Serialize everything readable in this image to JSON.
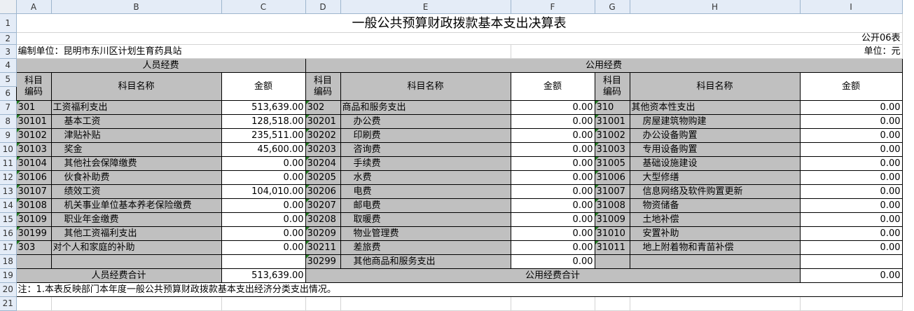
{
  "columns": [
    "A",
    "B",
    "C",
    "D",
    "E",
    "F",
    "G",
    "H",
    "I"
  ],
  "rows": [
    "1",
    "2",
    "3",
    "4",
    "5",
    "6",
    "7",
    "8",
    "9",
    "10",
    "11",
    "12",
    "13",
    "14",
    "15",
    "16",
    "17",
    "18",
    "19",
    "20",
    "21"
  ],
  "title": "一般公共预算财政拨款基本支出决算表",
  "table_no": "公开06表",
  "unit_label": "编制单位：昆明市东川区计划生育药具站",
  "currency": "单位：元",
  "section_personnel": "人员经费",
  "section_public": "公用经费",
  "hdr": {
    "code1": "科目",
    "code2": "编码",
    "name": "科目名称",
    "amount": "金额"
  },
  "personnel": [
    {
      "code": "301",
      "name": "工资福利支出",
      "amount": "513,639.00",
      "sub": false
    },
    {
      "code": "30101",
      "name": "基本工资",
      "amount": "128,518.00",
      "sub": true
    },
    {
      "code": "30102",
      "name": "津贴补贴",
      "amount": "235,511.00",
      "sub": true
    },
    {
      "code": "30103",
      "name": "奖金",
      "amount": "45,600.00",
      "sub": true
    },
    {
      "code": "30104",
      "name": "其他社会保障缴费",
      "amount": "0.00",
      "sub": true
    },
    {
      "code": "30106",
      "name": "伙食补助费",
      "amount": "0.00",
      "sub": true
    },
    {
      "code": "30107",
      "name": "绩效工资",
      "amount": "104,010.00",
      "sub": true
    },
    {
      "code": "30108",
      "name": "机关事业单位基本养老保险缴费",
      "amount": "0.00",
      "sub": true
    },
    {
      "code": "30109",
      "name": "职业年金缴费",
      "amount": "0.00",
      "sub": true
    },
    {
      "code": "30199",
      "name": "其他工资福利支出",
      "amount": "0.00",
      "sub": true
    },
    {
      "code": "303",
      "name": "对个人和家庭的补助",
      "amount": "0.00",
      "sub": false
    }
  ],
  "public1": [
    {
      "code": "302",
      "name": "商品和服务支出",
      "amount": "0.00",
      "sub": false
    },
    {
      "code": "30201",
      "name": "办公费",
      "amount": "0.00",
      "sub": true
    },
    {
      "code": "30202",
      "name": "印刷费",
      "amount": "0.00",
      "sub": true
    },
    {
      "code": "30203",
      "name": "咨询费",
      "amount": "0.00",
      "sub": true
    },
    {
      "code": "30204",
      "name": "手续费",
      "amount": "0.00",
      "sub": true
    },
    {
      "code": "30205",
      "name": "水费",
      "amount": "0.00",
      "sub": true
    },
    {
      "code": "30206",
      "name": "电费",
      "amount": "0.00",
      "sub": true
    },
    {
      "code": "30207",
      "name": "邮电费",
      "amount": "0.00",
      "sub": true
    },
    {
      "code": "30208",
      "name": "取暖费",
      "amount": "0.00",
      "sub": true
    },
    {
      "code": "30209",
      "name": "物业管理费",
      "amount": "0.00",
      "sub": true
    },
    {
      "code": "30211",
      "name": "差旅费",
      "amount": "0.00",
      "sub": true
    },
    {
      "code": "30299",
      "name": "其他商品和服务支出",
      "amount": "0.00",
      "sub": true
    }
  ],
  "public2": [
    {
      "code": "310",
      "name": "其他资本性支出",
      "amount": "0.00",
      "sub": false
    },
    {
      "code": "31001",
      "name": "房屋建筑物购建",
      "amount": "0.00",
      "sub": true
    },
    {
      "code": "31002",
      "name": "办公设备购置",
      "amount": "0.00",
      "sub": true
    },
    {
      "code": "31003",
      "name": "专用设备购置",
      "amount": "0.00",
      "sub": true
    },
    {
      "code": "31005",
      "name": "基础设施建设",
      "amount": "0.00",
      "sub": true
    },
    {
      "code": "31006",
      "name": "大型修缮",
      "amount": "0.00",
      "sub": true
    },
    {
      "code": "31007",
      "name": "信息网络及软件购置更新",
      "amount": "0.00",
      "sub": true
    },
    {
      "code": "31008",
      "name": "物资储备",
      "amount": "0.00",
      "sub": true
    },
    {
      "code": "31009",
      "name": "土地补偿",
      "amount": "0.00",
      "sub": true
    },
    {
      "code": "31010",
      "name": "安置补助",
      "amount": "0.00",
      "sub": true
    },
    {
      "code": "31011",
      "name": "地上附着物和青苗补偿",
      "amount": "0.00",
      "sub": true
    }
  ],
  "personnel_total_label": "人员经费合计",
  "personnel_total": "513,639.00",
  "public_total_label": "公用经费合计",
  "public_total": "0.00",
  "note": "注：1.本表反映部门本年度一般公共预算财政拨款基本支出经济分类支出情况。"
}
